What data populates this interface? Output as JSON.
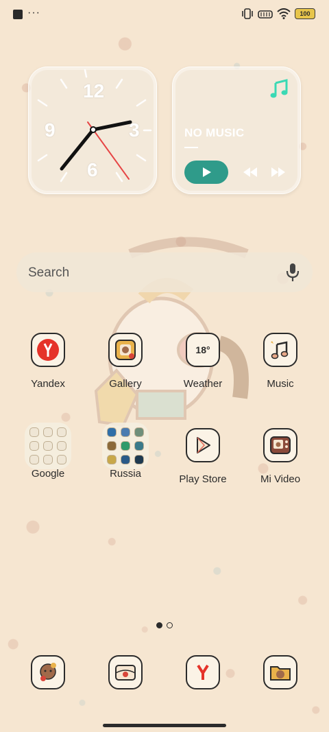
{
  "statusbar": {
    "more_indicator": "···",
    "battery_level": "100",
    "icons": [
      "stop-square-icon",
      "vibrate-icon",
      "volte-icon",
      "wifi-icon",
      "battery-icon"
    ]
  },
  "clock_widget": {
    "numerals": {
      "twelve": "12",
      "three": "3",
      "six": "6",
      "nine": "9"
    },
    "time": "2:35"
  },
  "music_widget": {
    "status": "NO MUSIC",
    "icons": [
      "music-note-icon",
      "play-icon",
      "rewind-icon",
      "fast-forward-icon"
    ],
    "accent": "#2f9b8a"
  },
  "search": {
    "placeholder": "Search"
  },
  "apps": {
    "row1": [
      {
        "label": "Yandex",
        "icon": "yandex-icon"
      },
      {
        "label": "Gallery",
        "icon": "gallery-icon"
      },
      {
        "label": "Weather",
        "icon": "weather-icon",
        "temp": "18°"
      },
      {
        "label": "Music",
        "icon": "music-icon"
      }
    ],
    "row2": [
      {
        "label": "Google",
        "icon": "folder-icon"
      },
      {
        "label": "Russia",
        "icon": "folder-icon"
      },
      {
        "label": "Play Store",
        "icon": "play-store-icon"
      },
      {
        "label": "Mi Video",
        "icon": "mi-video-icon"
      }
    ]
  },
  "pager": {
    "pages": 2,
    "current": 1
  },
  "dock": [
    "contacts-icon",
    "messages-icon",
    "yandex-browser-icon",
    "file-manager-icon"
  ],
  "colors": {
    "background": "#f6e6d1",
    "text": "#2b2b2b",
    "yandex_red": "#e5332a",
    "battery": "#e7c54b"
  }
}
